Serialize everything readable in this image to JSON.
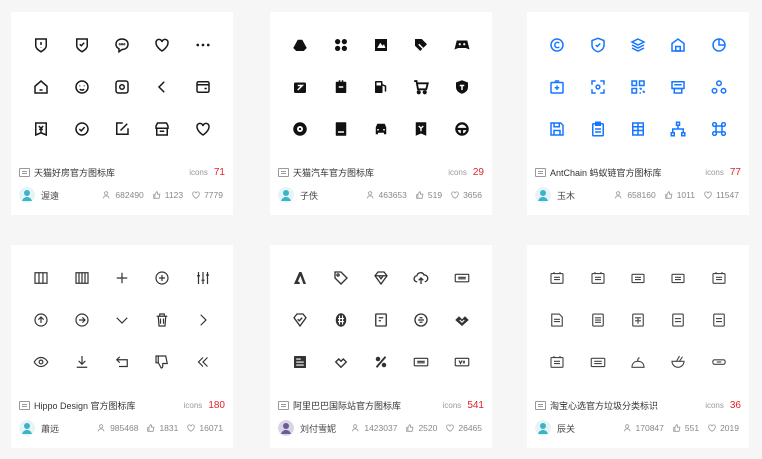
{
  "colors": {
    "black": "#1a1a1a",
    "blue": "#1677ff",
    "count_red": "#e3242b"
  },
  "icons_label": "icons",
  "cards": [
    {
      "title": "天猫好房官方图标库",
      "count": "71",
      "author": "渥遠",
      "views": "682490",
      "likes": "1123",
      "favs": "7779"
    },
    {
      "title": "天猫汽车官方图标库",
      "count": "29",
      "author": "子佚",
      "views": "463653",
      "likes": "519",
      "favs": "3656"
    },
    {
      "title": "AntChain 蚂蚁链官方图标库",
      "count": "77",
      "author": "玉木",
      "views": "658160",
      "likes": "1011",
      "favs": "11547"
    },
    {
      "title": "Hippo Design 官方图标库",
      "count": "180",
      "author": "蕭远",
      "views": "985468",
      "likes": "1831",
      "favs": "16071"
    },
    {
      "title": "阿里巴巴国际站官方图标库",
      "count": "541",
      "author": "刘付雪妮",
      "views": "1423037",
      "likes": "2520",
      "favs": "26465"
    },
    {
      "title": "淘宝心选官方垃圾分类标识",
      "count": "36",
      "author": "辰关",
      "views": "170847",
      "likes": "551",
      "favs": "2019"
    }
  ]
}
